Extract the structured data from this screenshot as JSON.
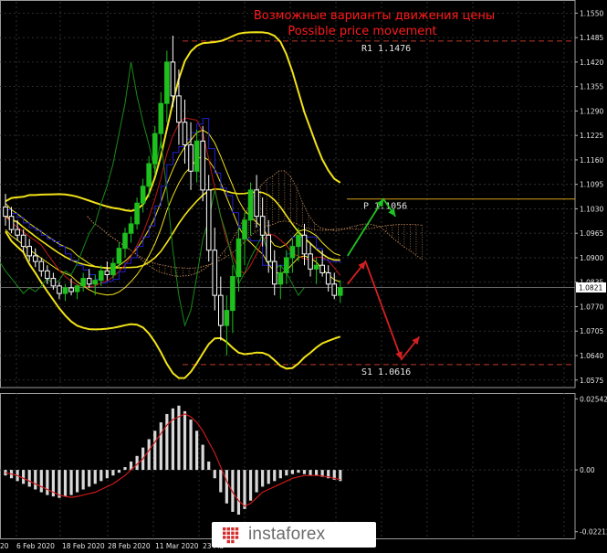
{
  "title": {
    "line1": "Возможные варианты движения цены",
    "line2": "Possible price movement"
  },
  "chart_data": [
    {
      "type": "line",
      "panel": "price",
      "y_ticks": [
        "1.1550",
        "1.1485",
        "1.1420",
        "1.1355",
        "1.1290",
        "1.1225",
        "1.1160",
        "1.1095",
        "1.1030",
        "1.0965",
        "1.0900",
        "1.0835",
        "1.0770",
        "1.0705",
        "1.0640",
        "1.0575"
      ],
      "ylim": [
        1.0555,
        1.158
      ],
      "current_price": 1.0821,
      "current_price_label": "1.0821",
      "levels": [
        {
          "name": "R1",
          "label": "R1 1.1476",
          "value": 1.1476,
          "color": "#c0392b"
        },
        {
          "name": "P",
          "label": "P 1.1056",
          "value": 1.1056,
          "color": "#d4a017"
        },
        {
          "name": "S1",
          "label": "S1 1.0616",
          "value": 1.0616,
          "color": "#c0392b"
        }
      ],
      "x_ticks": [
        "20",
        "6 Feb 2020",
        "18 Feb 2020",
        "28 Feb 2020",
        "11 Mar 2020",
        "23 Ma"
      ],
      "candles": [
        [
          1.1035,
          1.107,
          1.0985,
          1.101
        ],
        [
          1.101,
          1.1035,
          1.0965,
          1.0975
        ],
        [
          1.0975,
          1.1,
          1.0945,
          1.096
        ],
        [
          1.096,
          1.0975,
          1.0915,
          1.093
        ],
        [
          1.093,
          1.095,
          1.089,
          1.0905
        ],
        [
          1.0905,
          1.0925,
          1.0875,
          1.089
        ],
        [
          1.089,
          1.09,
          1.085,
          1.0865
        ],
        [
          1.0865,
          1.088,
          1.083,
          1.0845
        ],
        [
          1.0845,
          1.086,
          1.0815,
          1.0825
        ],
        [
          1.0825,
          1.0835,
          1.079,
          1.0805
        ],
        [
          1.0805,
          1.083,
          1.0785,
          1.082
        ],
        [
          1.082,
          1.0845,
          1.08,
          1.081
        ],
        [
          1.081,
          1.083,
          1.079,
          1.0825
        ],
        [
          1.0825,
          1.086,
          1.081,
          1.0845
        ],
        [
          1.0845,
          1.087,
          1.082,
          1.083
        ],
        [
          1.083,
          1.0855,
          1.08,
          1.084
        ],
        [
          1.084,
          1.088,
          1.0825,
          1.0865
        ],
        [
          1.0865,
          1.089,
          1.084,
          1.0855
        ],
        [
          1.0855,
          1.09,
          1.0845,
          1.0885
        ],
        [
          1.0885,
          1.094,
          1.087,
          1.0925
        ],
        [
          1.0925,
          1.098,
          1.09,
          1.0965
        ],
        [
          1.0965,
          1.101,
          1.094,
          1.099
        ],
        [
          1.099,
          1.106,
          1.0975,
          1.1045
        ],
        [
          1.1045,
          1.111,
          1.102,
          1.109
        ],
        [
          1.109,
          1.117,
          1.106,
          1.115
        ],
        [
          1.115,
          1.125,
          1.112,
          1.123
        ],
        [
          1.123,
          1.134,
          1.119,
          1.131
        ],
        [
          1.131,
          1.145,
          1.126,
          1.142
        ],
        [
          1.142,
          1.149,
          1.13,
          1.133
        ],
        [
          1.133,
          1.14,
          1.12,
          1.126
        ],
        [
          1.126,
          1.132,
          1.115,
          1.12
        ],
        [
          1.12,
          1.126,
          1.108,
          1.113
        ],
        [
          1.113,
          1.124,
          1.11,
          1.121
        ],
        [
          1.121,
          1.125,
          1.105,
          1.108
        ],
        [
          1.108,
          1.112,
          1.089,
          1.092
        ],
        [
          1.092,
          1.098,
          1.076,
          1.08
        ],
        [
          1.08,
          1.085,
          1.068,
          1.072
        ],
        [
          1.072,
          1.08,
          1.064,
          1.076
        ],
        [
          1.076,
          1.088,
          1.07,
          1.085
        ],
        [
          1.085,
          1.098,
          1.081,
          1.095
        ],
        [
          1.095,
          1.102,
          1.088,
          1.1
        ],
        [
          1.1,
          1.11,
          1.096,
          1.108
        ],
        [
          1.108,
          1.112,
          1.098,
          1.101
        ],
        [
          1.101,
          1.106,
          1.093,
          1.096
        ],
        [
          1.096,
          1.1,
          1.086,
          1.089
        ],
        [
          1.089,
          1.092,
          1.08,
          1.083
        ],
        [
          1.083,
          1.088,
          1.079,
          1.086
        ],
        [
          1.086,
          1.092,
          1.083,
          1.09
        ],
        [
          1.09,
          1.095,
          1.086,
          1.093
        ],
        [
          1.093,
          1.098,
          1.089,
          1.096
        ],
        [
          1.096,
          1.099,
          1.088,
          1.091
        ],
        [
          1.091,
          1.094,
          1.085,
          1.087
        ],
        [
          1.087,
          1.09,
          1.083,
          1.088
        ],
        [
          1.088,
          1.092,
          1.085,
          1.086
        ],
        [
          1.086,
          1.088,
          1.081,
          1.083
        ],
        [
          1.083,
          1.086,
          1.079,
          1.08
        ],
        [
          1.08,
          1.084,
          1.078,
          1.0821
        ]
      ],
      "pivot_target": 1.1056,
      "scenarios": [
        {
          "name": "bullish",
          "color": "#22c422",
          "points": [
            [
              56,
              1.0905
            ],
            [
              62,
              1.1056
            ],
            [
              64,
              1.101
            ]
          ]
        },
        {
          "name": "bearish",
          "color": "#d42020",
          "points": [
            [
              56,
              1.083
            ],
            [
              59,
              1.089
            ],
            [
              65,
              1.063
            ],
            [
              68,
              1.069
            ]
          ]
        }
      ]
    },
    {
      "type": "bar",
      "panel": "macd",
      "y_ticks": [
        "0.02542",
        "0.00",
        "-0.02212"
      ],
      "ylim": [
        -0.0245,
        0.0275
      ],
      "histogram": [
        -0.002,
        -0.003,
        -0.004,
        -0.005,
        -0.006,
        -0.007,
        -0.008,
        -0.009,
        -0.0095,
        -0.01,
        -0.0095,
        -0.009,
        -0.008,
        -0.007,
        -0.006,
        -0.005,
        -0.004,
        -0.003,
        -0.002,
        -0.001,
        0.001,
        0.003,
        0.005,
        0.008,
        0.011,
        0.014,
        0.017,
        0.02,
        0.022,
        0.023,
        0.021,
        0.018,
        0.014,
        0.009,
        0.003,
        -0.003,
        -0.008,
        -0.012,
        -0.015,
        -0.016,
        -0.014,
        -0.011,
        -0.008,
        -0.006,
        -0.005,
        -0.004,
        -0.003,
        -0.002,
        -0.0015,
        -0.001,
        -0.0015,
        -0.002,
        -0.002,
        -0.0025,
        -0.003,
        -0.0035,
        -0.004
      ],
      "signal": [
        -0.001,
        -0.0015,
        -0.002,
        -0.003,
        -0.004,
        -0.005,
        -0.006,
        -0.007,
        -0.008,
        -0.009,
        -0.0095,
        -0.0098,
        -0.0095,
        -0.009,
        -0.0085,
        -0.008,
        -0.007,
        -0.006,
        -0.005,
        -0.0035,
        -0.002,
        0.0,
        0.002,
        0.004,
        0.007,
        0.01,
        0.013,
        0.016,
        0.018,
        0.019,
        0.02,
        0.019,
        0.017,
        0.014,
        0.01,
        0.006,
        0.001,
        -0.004,
        -0.008,
        -0.011,
        -0.013,
        -0.012,
        -0.01,
        -0.008,
        -0.007,
        -0.006,
        -0.005,
        -0.004,
        -0.003,
        -0.0025,
        -0.002,
        -0.002,
        -0.002,
        -0.0022,
        -0.0025,
        -0.003,
        -0.0035
      ]
    }
  ],
  "colors": {
    "background": "#000000",
    "grid": "#3a3a3a",
    "candle_up": "#1ec01e",
    "candle_down": "#ffffff",
    "bollinger": "#f2e318",
    "ma_red": "#c01818",
    "ma_blue": "#2020d0",
    "ma_green": "#1a8a1a",
    "cloud": "#c88a5a",
    "macd_hist": "#d8d8d8",
    "macd_signal": "#cc1a1a"
  },
  "logo": {
    "text": "instaforex",
    "mark_icon": "instaforex-logo-icon"
  }
}
